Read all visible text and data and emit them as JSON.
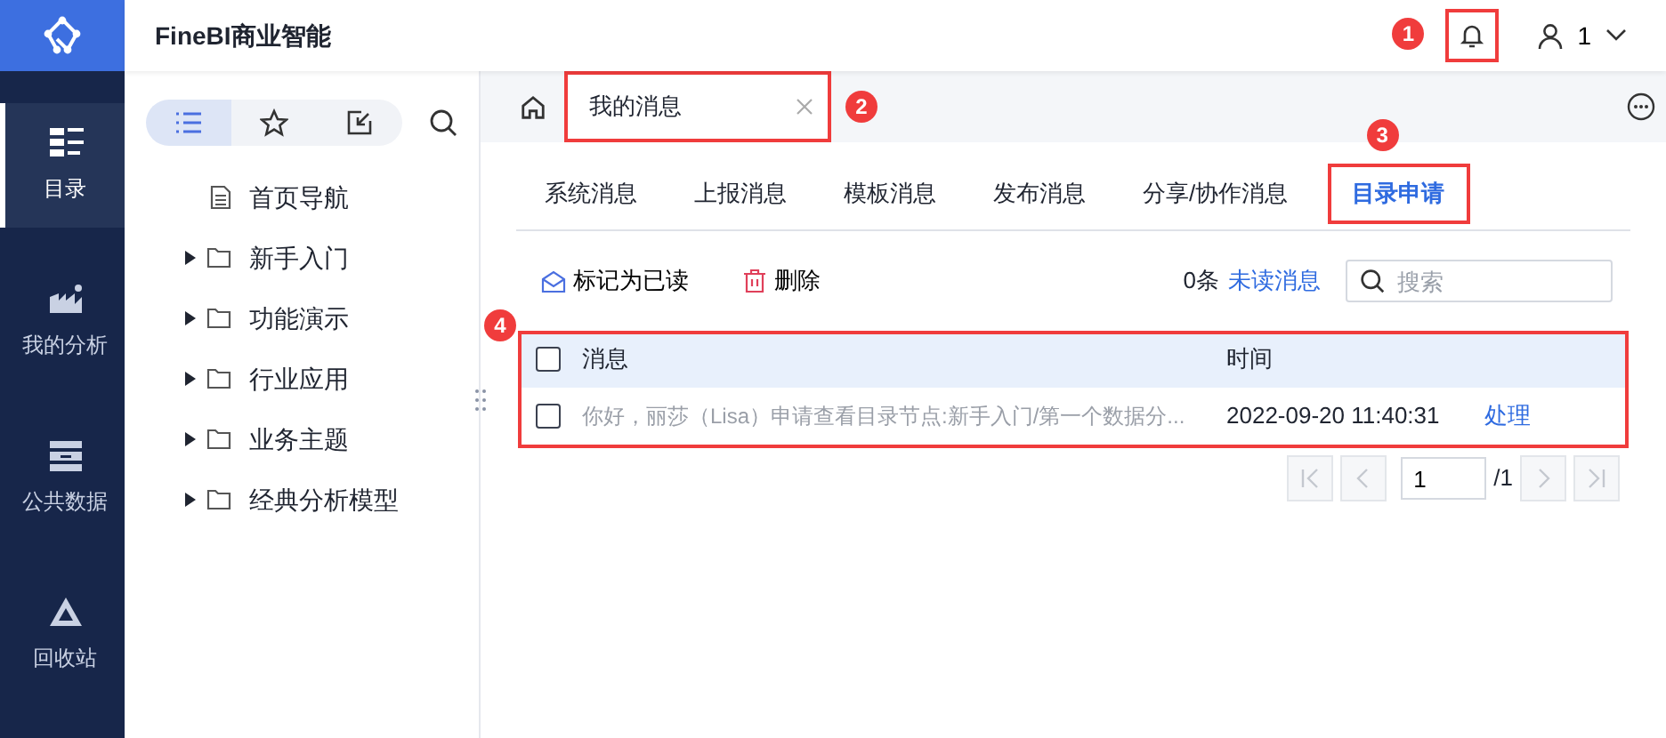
{
  "app": {
    "title": "FineBI商业智能",
    "user": "1",
    "bell_callout": "1"
  },
  "rail": [
    {
      "label": "目录",
      "kind": "catalog",
      "selected": true
    },
    {
      "label": "我的分析",
      "kind": "analysis",
      "selected": false
    },
    {
      "label": "公共数据",
      "kind": "data",
      "selected": false
    },
    {
      "label": "回收站",
      "kind": "recycle",
      "selected": false
    }
  ],
  "tree_tools": [
    {
      "kind": "list",
      "selected": true
    },
    {
      "kind": "star",
      "selected": false
    },
    {
      "kind": "share",
      "selected": false
    },
    {
      "kind": "search",
      "selected": false
    }
  ],
  "tree": [
    {
      "label": "首页导航",
      "kind": "page"
    },
    {
      "label": "新手入门",
      "kind": "folder",
      "expanded": false
    },
    {
      "label": "功能演示",
      "kind": "folder",
      "expanded": false
    },
    {
      "label": "行业应用",
      "kind": "folder",
      "expanded": false
    },
    {
      "label": "业务主题",
      "kind": "folder",
      "expanded": false
    },
    {
      "label": "经典分析模型",
      "kind": "folder",
      "expanded": false
    }
  ],
  "open_tab": {
    "label": "我的消息",
    "callout": "2"
  },
  "message_tabs": [
    {
      "label": "系统消息",
      "selected": false
    },
    {
      "label": "上报消息",
      "selected": false
    },
    {
      "label": "模板消息",
      "selected": false
    },
    {
      "label": "发布消息",
      "selected": false
    },
    {
      "label": "分享/协作消息",
      "selected": false
    },
    {
      "label": "目录申请",
      "selected": true,
      "callout": "3"
    }
  ],
  "toolbar": {
    "mark_read": "标记为已读",
    "delete": "删除",
    "count": "0条",
    "unread": "未读消息",
    "search_placeholder": "搜索"
  },
  "table": {
    "callout": "4",
    "all_checked": false,
    "columns": [
      "消息",
      "时间"
    ],
    "rows": [
      {
        "message": "你好，丽莎（Lisa）申请查看目录节点:新手入门/第一个数据分...",
        "time": "2022-09-20 11:40:31",
        "action": "处理",
        "checked": false,
        "read": true
      }
    ]
  },
  "pager": {
    "page": "1",
    "total": "/1"
  }
}
